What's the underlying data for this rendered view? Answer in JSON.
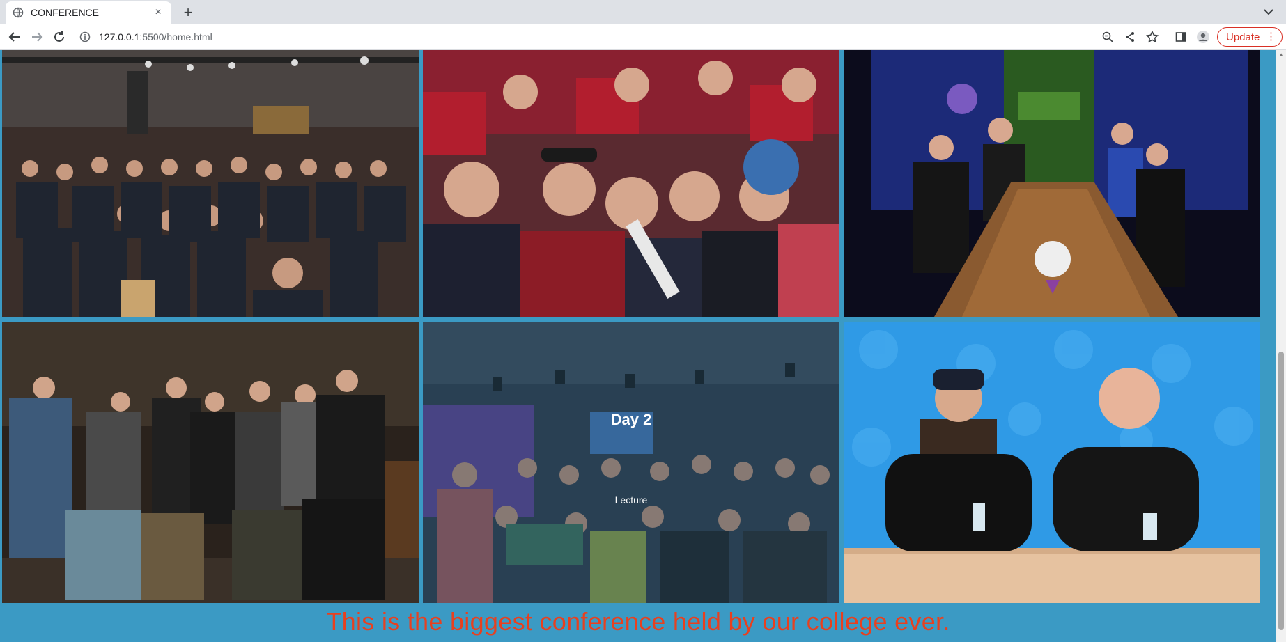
{
  "browser": {
    "tab_title": "CONFERENCE",
    "tab_close": "×",
    "new_tab": "+",
    "url_host": "127.0.0.1",
    "url_path": ":5500/home.html",
    "update_label": "Update",
    "menu_dots": "⋮"
  },
  "gallery": {
    "tiles": [
      {
        "description": "audience-photo"
      },
      {
        "description": "audience-closeup"
      },
      {
        "description": "podcast-table"
      },
      {
        "description": "group-photo"
      },
      {
        "description": "lecture-hall",
        "title": "Day 2",
        "subtitle": "Lecture"
      },
      {
        "description": "two-hosts"
      }
    ]
  },
  "caption": "This is the biggest conference held by our college ever.",
  "colors": {
    "page_background": "#3b9ac4",
    "caption_color": "#e8401f",
    "update_accent": "#d93025"
  }
}
